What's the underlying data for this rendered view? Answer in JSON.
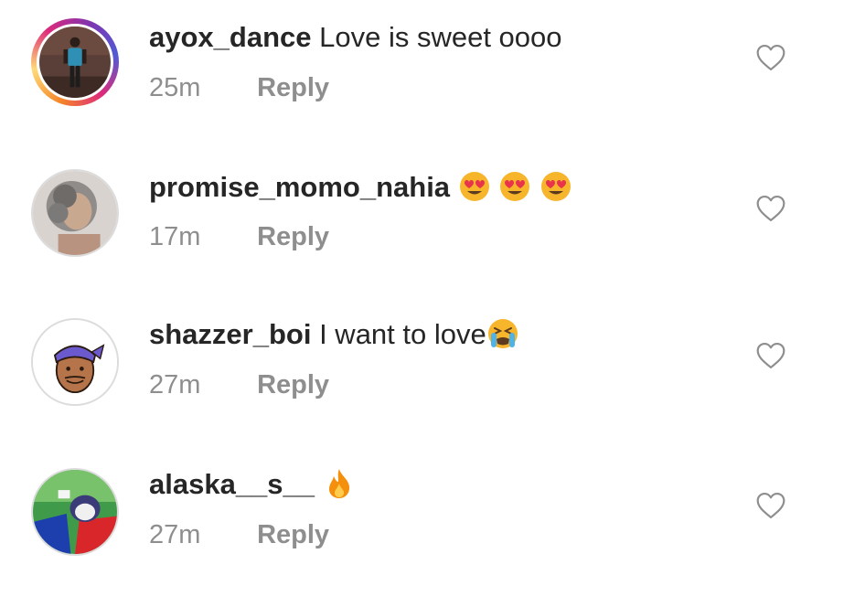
{
  "comments": [
    {
      "username": "ayox_dance",
      "text": "Love is sweet oooo",
      "time": "25m",
      "reply_label": "Reply",
      "has_story_ring": true,
      "emojis": []
    },
    {
      "username": "promise_momo_nahia",
      "text": "",
      "time": "17m",
      "reply_label": "Reply",
      "has_story_ring": false,
      "emojis": [
        "heart-eyes-emoji",
        "heart-eyes-emoji",
        "heart-eyes-emoji"
      ]
    },
    {
      "username": "shazzer_boi",
      "text": "I want to love",
      "time": "27m",
      "reply_label": "Reply",
      "has_story_ring": false,
      "emojis": [
        "crying-loudly-emoji"
      ]
    },
    {
      "username": "alaska__s__",
      "text": "",
      "time": "27m",
      "reply_label": "Reply",
      "has_story_ring": false,
      "emojis": [
        "fire-emoji"
      ]
    }
  ],
  "icons": {
    "like": "heart-outline-icon"
  },
  "colors": {
    "text": "#262626",
    "muted": "#8e8e8e",
    "background": "#ffffff"
  }
}
